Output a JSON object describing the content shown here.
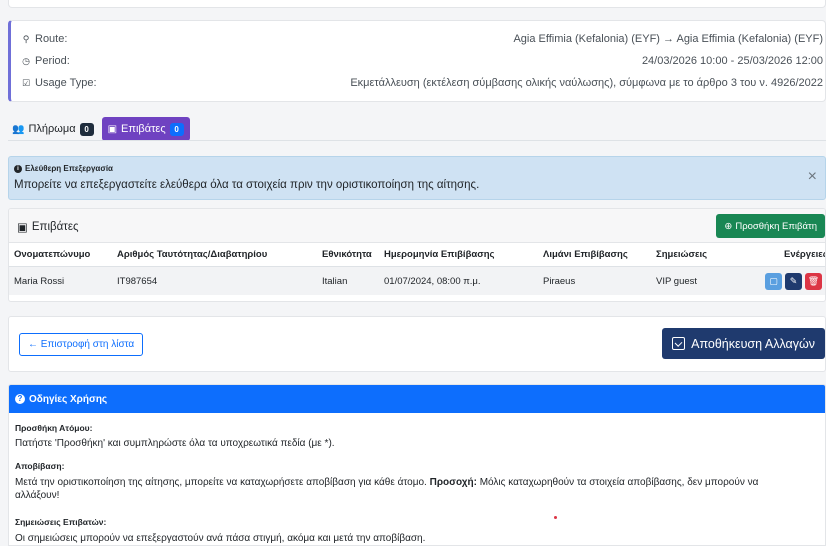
{
  "info": {
    "route_label": "Route:",
    "route_value": "Agia Effimia (Kefalonia) (EYF) → Agia Effimia (Kefalonia) (EYF)",
    "period_label": "Period:",
    "period_value": "24/03/2026 10:00 - 25/03/2026 12:00",
    "usage_label": "Usage Type:",
    "usage_value": "Εκμετάλλευση (εκτέλεση σύμβασης ολικής ναύλωσης), σύμφωνα με το άρθρο 3 του ν. 4926/2022"
  },
  "tabs": [
    {
      "label": "Πλήρωμα",
      "count": "0"
    },
    {
      "label": "Επιβάτες",
      "count": "0"
    }
  ],
  "alert": {
    "title": "Ελεύθερη Επεξεργασία",
    "text": "Μπορείτε να επεξεργαστείτε ελεύθερα όλα τα στοιχεία πριν την οριστικοποίηση της αίτησης.",
    "close": "×"
  },
  "passengers": {
    "title": "Επιβάτες",
    "add_label": "Προσθήκη Επιβάτη",
    "columns": [
      "Ονοματεπώνυμο",
      "Αριθμός Ταυτότητας/Διαβατηρίου",
      "Εθνικότητα",
      "Ημερομηνία Επιβίβασης",
      "Λιμάνι Επιβίβασης",
      "Σημειώσεις",
      "Ενέργειες"
    ],
    "rows": [
      {
        "name": "Maria Rossi",
        "id": "IT987654",
        "nationality": "Italian",
        "date": "01/07/2024, 08:00 π.μ.",
        "port": "Piraeus",
        "notes": "VIP guest"
      }
    ]
  },
  "actions": {
    "back_label": "← Επιστροφή στη λίστα",
    "save_label": "Αποθήκευση Αλλαγών"
  },
  "guide": {
    "title": "Οδηγίες Χρήσης",
    "sections": [
      {
        "title": "Προσθήκη Ατόμου:",
        "text": "Πατήστε 'Προσθήκη' και συμπληρώστε όλα τα υποχρεωτικά πεδία (με *)."
      },
      {
        "title": "Αποβίβαση:",
        "text_before": "Μετά την οριστικοποίηση της αίτησης, μπορείτε να καταχωρήσετε αποβίβαση για κάθε άτομο. ",
        "bold": "Προσοχή:",
        "text_after": " Μόλις καταχωρηθούν τα στοιχεία αποβίβασης, δεν μπορούν να αλλάξουν!"
      },
      {
        "title": "Σημειώσεις Επιβατών:",
        "text": "Οι σημειώσεις μπορούν να επεξεργαστούν ανά πάσα στιγμή, ακόμα και μετά την αποβίβαση."
      }
    ]
  }
}
